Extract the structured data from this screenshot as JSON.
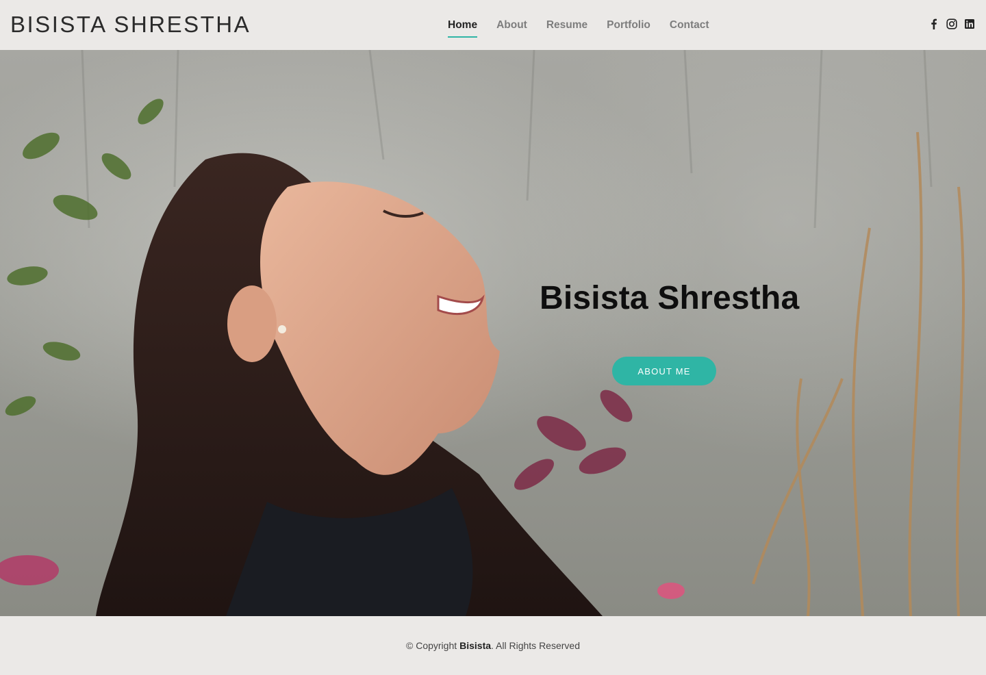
{
  "header": {
    "logo": "BISISTA SHRESTHA",
    "nav": [
      {
        "label": "Home",
        "active": true
      },
      {
        "label": "About",
        "active": false
      },
      {
        "label": "Resume",
        "active": false
      },
      {
        "label": "Portfolio",
        "active": false
      },
      {
        "label": "Contact",
        "active": false
      }
    ],
    "socials": [
      "facebook-icon",
      "instagram-icon",
      "linkedin-icon"
    ]
  },
  "hero": {
    "title": "Bisista Shrestha",
    "button_label": "About Me"
  },
  "footer": {
    "copyright_prefix": "© Copyright",
    "name": "Bisista",
    "suffix": ". All Rights Reserved"
  },
  "colors": {
    "accent": "#2fb5a5",
    "background": "#ebe9e7",
    "text_dark": "#222222",
    "nav_inactive": "#7d7d7d"
  }
}
